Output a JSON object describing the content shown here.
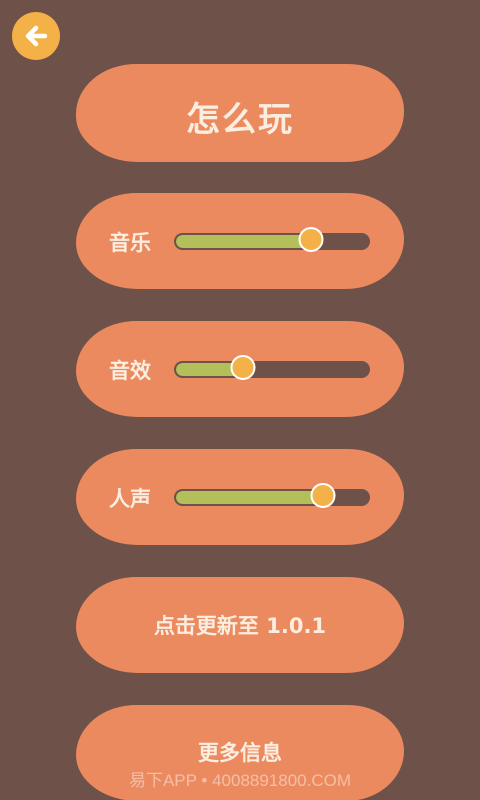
{
  "header": {
    "back_icon": "arrow-left-icon"
  },
  "title": "怎么玩",
  "sliders": [
    {
      "label": "音乐",
      "value": 0.7
    },
    {
      "label": "音效",
      "value": 0.35
    },
    {
      "label": "人声",
      "value": 0.76
    }
  ],
  "update_label": "点击更新至 1.0.1",
  "more_info_label": "更多信息",
  "watermark": "易下APP • 4008891800.COM",
  "colors": {
    "background": "#6e5149",
    "pill": "#ec8a5f",
    "accent": "#f3b148",
    "slider_fill": "#b3bf58",
    "text": "#fbeee0"
  }
}
